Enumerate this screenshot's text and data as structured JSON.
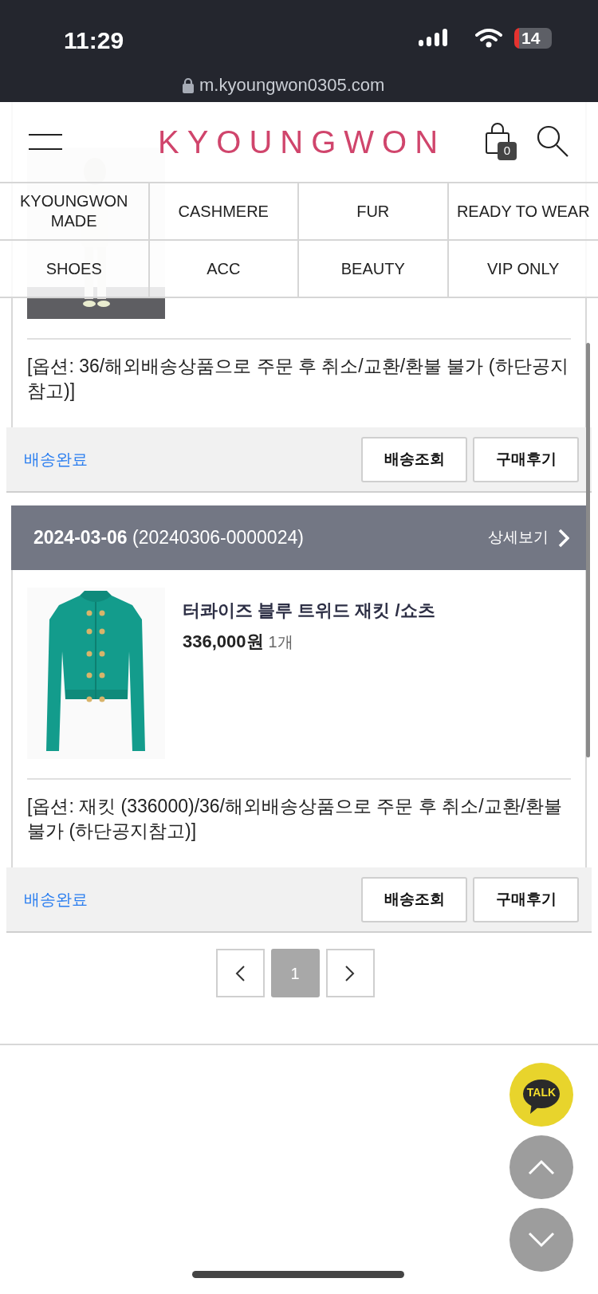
{
  "status_bar": {
    "time": "11:29",
    "battery": "14"
  },
  "browser": {
    "url": "m.kyoungwon0305.com"
  },
  "header": {
    "logo": "KYOUNGWON",
    "cart_count": "0"
  },
  "categories": [
    {
      "label": "KYOUNGWON MADE"
    },
    {
      "label": "CASHMERE"
    },
    {
      "label": "FUR"
    },
    {
      "label": "READY TO WEAR"
    },
    {
      "label": "SHOES"
    },
    {
      "label": "ACC"
    },
    {
      "label": "BEAUTY"
    },
    {
      "label": "VIP ONLY"
    }
  ],
  "orders": [
    {
      "option": "[옵션: 36/해외배송상품으로 주문 후 취소/교환/환불 불가 (하단공지참고)]",
      "status": "배송완료",
      "buttons": [
        "배송조회",
        "구매후기"
      ]
    },
    {
      "date": "2024-03-06",
      "order_number": "(20240306-0000024)",
      "detail_link": "상세보기",
      "product_name": "터콰이즈 블루 트위드 재킷 /쇼츠",
      "price": "336,000원",
      "quantity": "1개",
      "option": "[옵션: 재킷 (336000)/36/해외배송상품으로 주문 후 취소/교환/환불 불가 (하단공지참고)]",
      "status": "배송완료",
      "buttons": [
        "배송조회",
        "구매후기"
      ]
    }
  ],
  "pagination": {
    "pages": [
      {
        "label": "1",
        "selected": true
      }
    ]
  },
  "floating": {
    "talk": "TALK"
  }
}
